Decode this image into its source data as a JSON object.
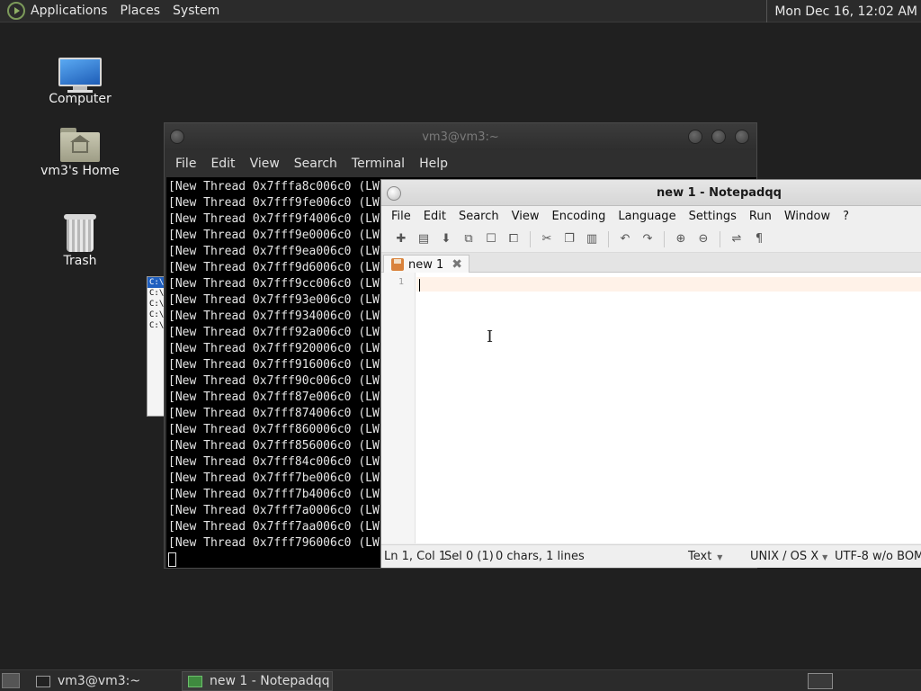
{
  "top_panel": {
    "menu": [
      "Applications",
      "Places",
      "System"
    ],
    "clock": "Mon Dec 16, 12:02 AM"
  },
  "desktop_icons": [
    {
      "label": "Computer",
      "icon": "computer-icon"
    },
    {
      "label": "vm3's Home",
      "icon": "home-folder-icon"
    },
    {
      "label": "Trash",
      "icon": "trash-icon"
    }
  ],
  "bg_cmd_lines": [
    "C:\\",
    "C:\\",
    "C:\\",
    "C:\\",
    "C:\\"
  ],
  "terminal": {
    "title": "vm3@vm3:~",
    "menu": [
      "File",
      "Edit",
      "View",
      "Search",
      "Terminal",
      "Help"
    ],
    "lines": [
      "[New Thread 0x7fffa8c006c0 (LW",
      "[New Thread 0x7fff9fe006c0 (LW",
      "[New Thread 0x7fff9f4006c0 (LW",
      "[New Thread 0x7fff9e0006c0 (LW",
      "[New Thread 0x7fff9ea006c0 (LW",
      "[New Thread 0x7fff9d6006c0 (LW",
      "[New Thread 0x7fff9cc006c0 (LW",
      "[New Thread 0x7fff93e006c0 (LW",
      "[New Thread 0x7fff934006c0 (LW",
      "[New Thread 0x7fff92a006c0 (LW",
      "[New Thread 0x7fff920006c0 (LW",
      "[New Thread 0x7fff916006c0 (LW",
      "[New Thread 0x7fff90c006c0 (LW",
      "[New Thread 0x7fff87e006c0 (LW",
      "[New Thread 0x7fff874006c0 (LW",
      "[New Thread 0x7fff860006c0 (LW",
      "[New Thread 0x7fff856006c0 (LW",
      "[New Thread 0x7fff84c006c0 (LW",
      "[New Thread 0x7fff7be006c0 (LW",
      "[New Thread 0x7fff7b4006c0 (LW",
      "[New Thread 0x7fff7a0006c0 (LW",
      "[New Thread 0x7fff7aa006c0 (LW",
      "[New Thread 0x7fff796006c0 (LW"
    ]
  },
  "notepadqq": {
    "title": "new 1 - Notepadqq",
    "menu": [
      "File",
      "Edit",
      "Search",
      "View",
      "Encoding",
      "Language",
      "Settings",
      "Run",
      "Window",
      "?"
    ],
    "toolbar": [
      {
        "icon": "new-file-icon",
        "glyph": "✚"
      },
      {
        "icon": "open-file-icon",
        "glyph": "▤"
      },
      {
        "icon": "save-icon",
        "glyph": "⬇"
      },
      {
        "icon": "save-all-icon",
        "glyph": "⧉"
      },
      {
        "icon": "close-icon",
        "glyph": "☐"
      },
      {
        "icon": "close-all-icon",
        "glyph": "⧠"
      },
      {
        "sep": true
      },
      {
        "icon": "cut-icon",
        "glyph": "✂"
      },
      {
        "icon": "copy-icon",
        "glyph": "❐"
      },
      {
        "icon": "paste-icon",
        "glyph": "▥"
      },
      {
        "sep": true
      },
      {
        "icon": "undo-icon",
        "glyph": "↶"
      },
      {
        "icon": "redo-icon",
        "glyph": "↷"
      },
      {
        "sep": true
      },
      {
        "icon": "zoom-in-icon",
        "glyph": "⊕"
      },
      {
        "icon": "zoom-out-icon",
        "glyph": "⊖"
      },
      {
        "sep": true
      },
      {
        "icon": "word-wrap-icon",
        "glyph": "⇌"
      },
      {
        "icon": "show-all-chars-icon",
        "glyph": "¶"
      }
    ],
    "tab_label": "new 1",
    "tab_close": "✖",
    "line_number": "1",
    "status": {
      "position": "Ln 1, Col 1",
      "selection": "Sel 0 (1)",
      "counts": "0 chars, 1 lines",
      "language": "Text",
      "eol": "UNIX / OS X",
      "encoding": "UTF-8 w/o BOM"
    }
  },
  "taskbar": {
    "tasks": [
      {
        "label": "vm3@vm3:~",
        "active": false
      },
      {
        "label": "new 1 - Notepadqq",
        "active": true
      }
    ]
  }
}
